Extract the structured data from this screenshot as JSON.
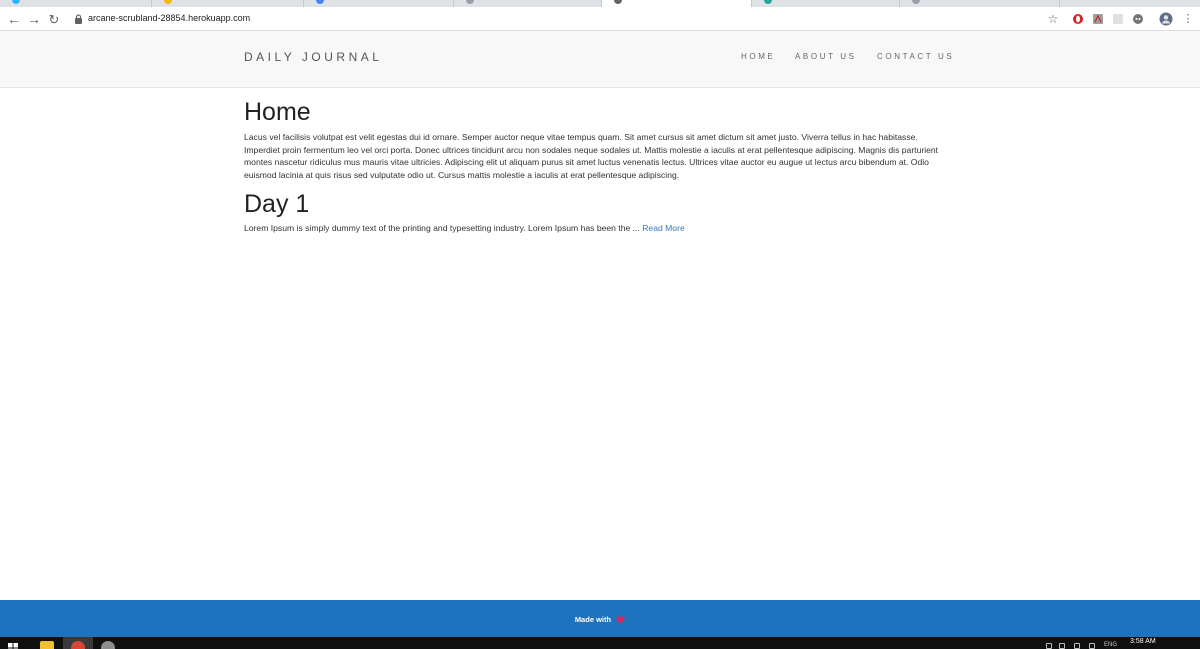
{
  "browser": {
    "url": "arcane-scrubland-28854.herokuapp.com"
  },
  "site": {
    "brand": "DAILY JOURNAL",
    "nav": [
      "HOME",
      "ABOUT US",
      "CONTACT US"
    ]
  },
  "home": {
    "title": "Home",
    "body": "Lacus vel facilisis volutpat est velit egestas dui id ornare. Semper auctor neque vitae tempus quam. Sit amet cursus sit amet dictum sit amet justo. Viverra tellus in hac habitasse. Imperdiet proin fermentum leo vel orci porta. Donec ultrices tincidunt arcu non sodales neque sodales ut. Mattis molestie a iaculis at erat pellentesque adipiscing. Magnis dis parturient montes nascetur ridiculus mus mauris vitae ultricies. Adipiscing elit ut aliquam purus sit amet luctus venenatis lectus. Ultrices vitae auctor eu augue ut lectus arcu bibendum at. Odio euismod lacinia at quis risus sed vulputate odio ut. Cursus mattis molestie a iaculis at erat pellentesque adipiscing."
  },
  "posts": [
    {
      "title": "Day 1",
      "excerpt": "Lorem Ipsum is simply dummy text of the printing and typesetting industry. Lorem Ipsum has been the ...",
      "read_more": "Read More"
    }
  ],
  "footer": {
    "text": "Made with",
    "heart_color": "#e0245e"
  },
  "taskbar": {
    "lang": "ENG",
    "time": "3:58 AM"
  },
  "colors": {
    "footer_bg": "#1e73be",
    "link": "#337ab7"
  }
}
